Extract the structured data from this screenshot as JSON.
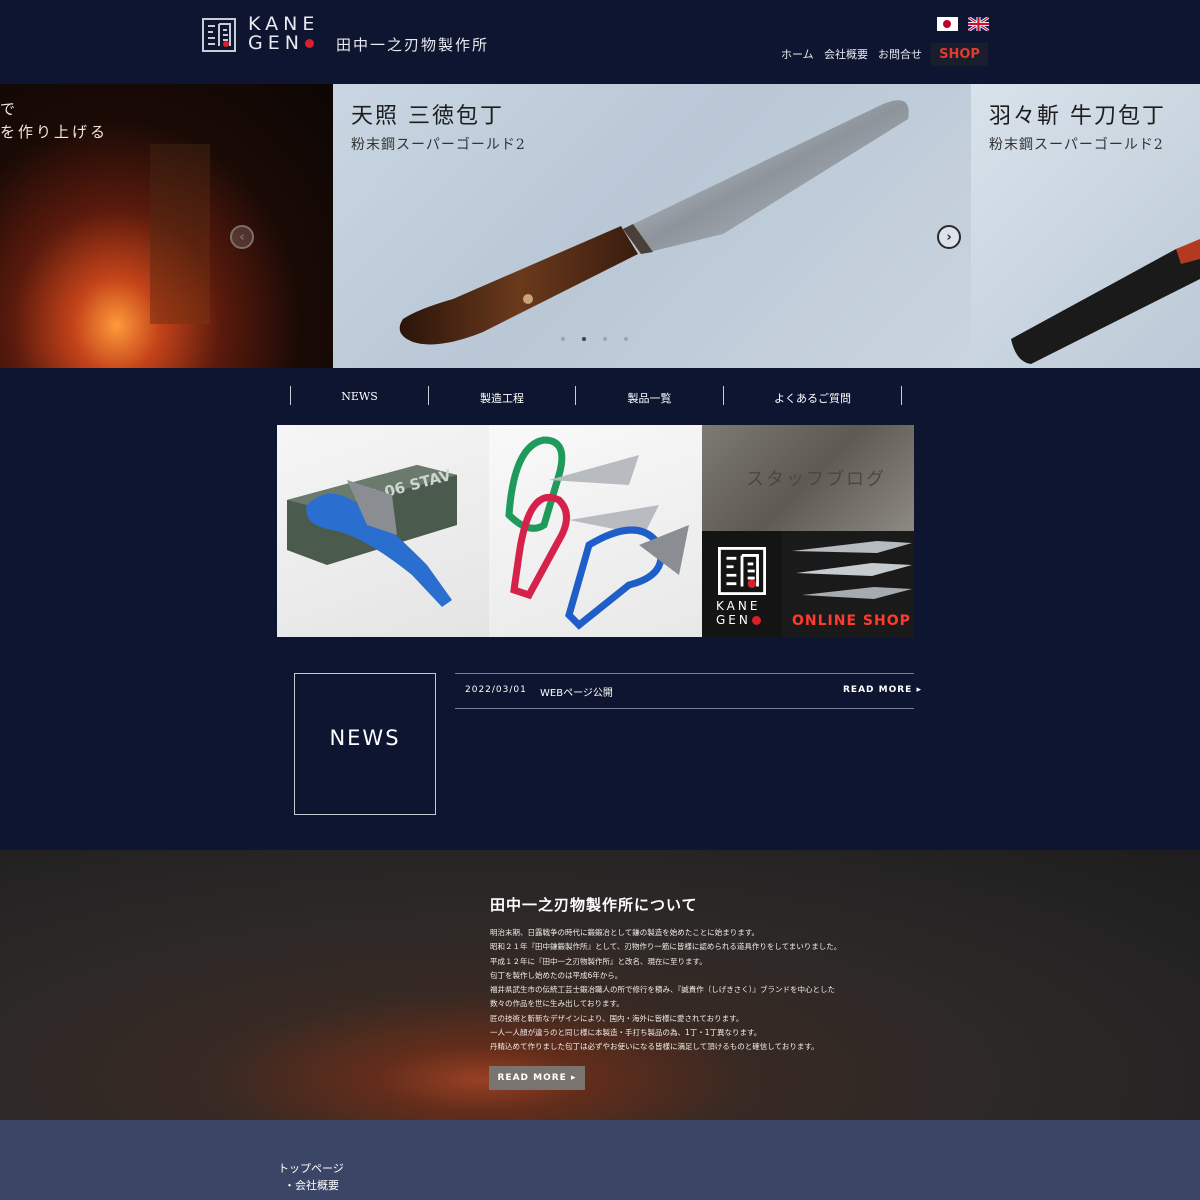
{
  "header": {
    "logo_text_line1": "KANE",
    "logo_text_line2": "GEN",
    "company_name": "田中一之刃物製作所",
    "nav": [
      "ホーム",
      "会社概要",
      "お問合せ"
    ],
    "shop_label": "SHOP",
    "languages": [
      "jp-flag-icon",
      "uk-flag-icon"
    ]
  },
  "hero": {
    "left_slide_lines": [
      "で",
      "を作り上げる"
    ],
    "center_title": "天照 三徳包丁",
    "center_sub": "粉末鋼スーパーゴールド2",
    "right_title": "羽々斬 牛刀包丁",
    "right_sub": "粉末鋼スーパーゴールド2",
    "active_dot": 1
  },
  "subnav": [
    "NEWS",
    "製造工程",
    "製品一覧",
    "よくあるご質問"
  ],
  "tiles": {
    "blog_label": "スタッフブログ",
    "shop_label": "ONLINE SHOP",
    "box_text": "XG-06 STAV"
  },
  "news": {
    "heading": "NEWS",
    "items": [
      {
        "date": "2022/03/01",
        "title": "WEBページ公開",
        "more": "READ MORE"
      }
    ]
  },
  "about": {
    "title": "田中一之刃物製作所について",
    "lines": [
      "明治末期、日露戦争の時代に鍛鍛冶として鎌の製造を始めたことに始まります。",
      "昭和２１年『田中鎌鍛製作所』として、刃物作り一筋に皆様に認められる道具作りをしてまいりました。",
      "平成１２年に『田中一之刃物製作所』と改名、現在に至ります。",
      "包丁を製作し始めたのは平成6年から。",
      "福井県武生市の伝統工芸士鍛冶職人の所で修行を積み、『誠貴作（しげきさく）』ブランドを中心とした",
      "数々の作品を世に生み出しております。",
      "匠の技術と斬新なデザインにより、国内・海外に皆様に愛されております。",
      "一人一人顔が違うのと同じ様に本製造・手打ち製品の為、1丁・1丁異なります。",
      "丹精込めて作りました包丁は必ずやお使いになる皆様に満足して頂けるものと確信しております。"
    ],
    "button": "READ MORE"
  },
  "footer": {
    "links": [
      "トップページ",
      "・会社概要"
    ]
  },
  "colors": {
    "page_bg": "#0d1530",
    "footer_bg": "#3b4565",
    "shop_red": "#e03b2e",
    "accent_red": "#d8202a"
  }
}
